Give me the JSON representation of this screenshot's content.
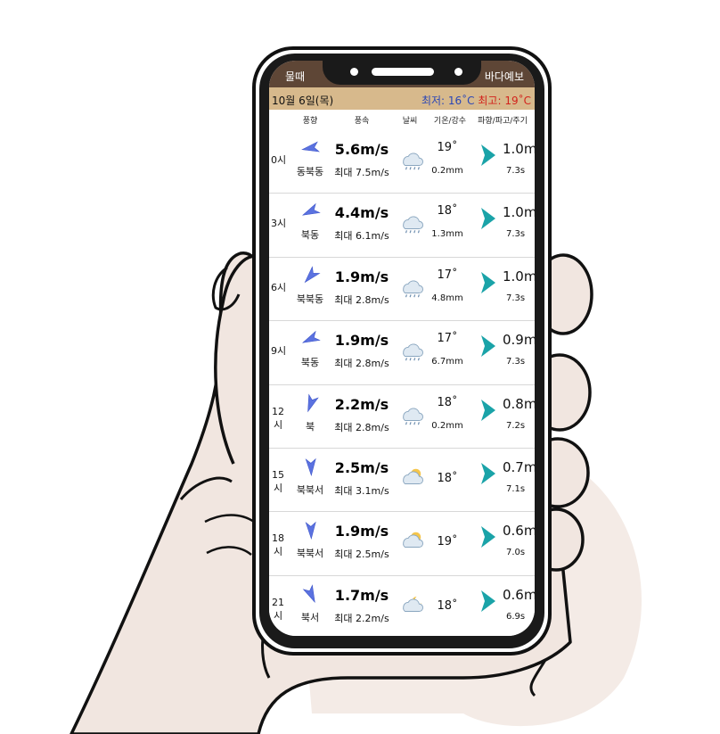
{
  "app": {
    "tab_left": "물때",
    "tab_right": "바다예보"
  },
  "date_bar": {
    "date": "10월 6일(목)",
    "min_label": "최저:",
    "min_value": "16˚C",
    "max_label": "최고:",
    "max_value": "19˚C"
  },
  "columns": [
    "풍향",
    "풍속",
    "날씨",
    "기온/강수",
    "파향/파고/주기"
  ],
  "colors": {
    "topbar": "#5e4636",
    "datebar": "#d7b98c",
    "min_text": "#2a46b6",
    "max_text": "#d2231c",
    "wave_arrow": "#1aa3a8"
  },
  "rows": [
    {
      "time": "0시",
      "dir": "동북동",
      "speed": "5.6m/s",
      "gust": "최대 7.5m/s",
      "weather": "rain-cloud-icon",
      "temp": "19˚",
      "rain": "0.2mm",
      "wave_h": "1.0m",
      "wave_p": "7.3s"
    },
    {
      "time": "3시",
      "dir": "북동",
      "speed": "4.4m/s",
      "gust": "최대 6.1m/s",
      "weather": "rain-cloud-icon",
      "temp": "18˚",
      "rain": "1.3mm",
      "wave_h": "1.0m",
      "wave_p": "7.3s"
    },
    {
      "time": "6시",
      "dir": "북북동",
      "speed": "1.9m/s",
      "gust": "최대 2.8m/s",
      "weather": "rain-cloud-icon",
      "temp": "17˚",
      "rain": "4.8mm",
      "wave_h": "1.0m",
      "wave_p": "7.3s"
    },
    {
      "time": "9시",
      "dir": "북동",
      "speed": "1.9m/s",
      "gust": "최대 2.8m/s",
      "weather": "rain-cloud-icon",
      "temp": "17˚",
      "rain": "6.7mm",
      "wave_h": "0.9m",
      "wave_p": "7.3s"
    },
    {
      "time": "12시",
      "dir": "북",
      "speed": "2.2m/s",
      "gust": "최대 2.8m/s",
      "weather": "rain-cloud-icon",
      "temp": "18˚",
      "rain": "0.2mm",
      "wave_h": "0.8m",
      "wave_p": "7.2s"
    },
    {
      "time": "15시",
      "dir": "북북서",
      "speed": "2.5m/s",
      "gust": "최대 3.1m/s",
      "weather": "partly-cloudy-icon",
      "temp": "18˚",
      "rain": "",
      "wave_h": "0.7m",
      "wave_p": "7.1s"
    },
    {
      "time": "18시",
      "dir": "북북서",
      "speed": "1.9m/s",
      "gust": "최대 2.5m/s",
      "weather": "partly-cloudy-icon",
      "temp": "19˚",
      "rain": "",
      "wave_h": "0.6m",
      "wave_p": "7.0s"
    },
    {
      "time": "21시",
      "dir": "북서",
      "speed": "1.7m/s",
      "gust": "최대 2.2m/s",
      "weather": "night-cloudy-icon",
      "temp": "18˚",
      "rain": "",
      "wave_h": "0.6m",
      "wave_p": "6.9s"
    }
  ]
}
